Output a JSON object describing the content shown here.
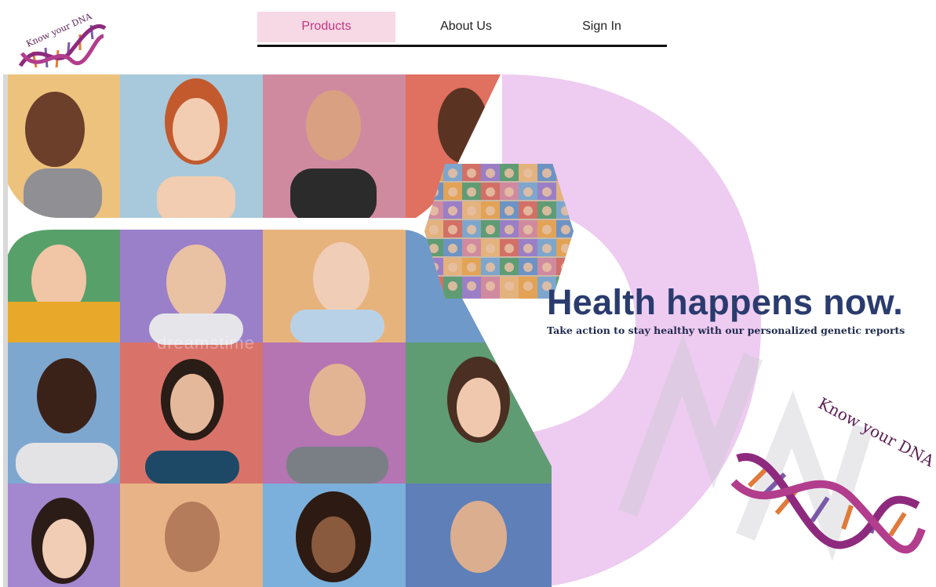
{
  "brand": {
    "logo_text": "Know your DNA"
  },
  "nav": {
    "items": [
      {
        "label": "Products",
        "active": true
      },
      {
        "label": "About Us",
        "active": false
      },
      {
        "label": "Sign In",
        "active": false
      }
    ]
  },
  "hero": {
    "headline": "Health happens now.",
    "tagline": "Take action to stay healthy with our personalized genetic reports",
    "watermark": "dreamstime"
  },
  "colors": {
    "accent_pink": "#c2347f",
    "nav_active_bg": "#f7d9e5",
    "arc_pink": "#eecbf0",
    "headline_navy": "#2a3b6e",
    "dna_purple": "#7a2f7a",
    "dna_orange": "#e07a3a"
  }
}
